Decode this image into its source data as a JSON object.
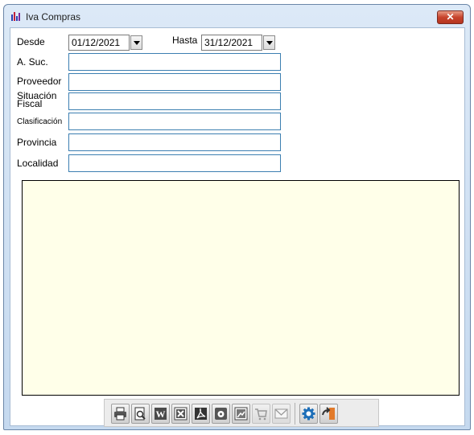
{
  "window": {
    "title": "Iva Compras",
    "close_symbol": "✕"
  },
  "form": {
    "desde_label": "Desde",
    "desde_value": "01/12/2021",
    "hasta_label": "Hasta",
    "hasta_value": "31/12/2021",
    "suc_label": "A. Suc.",
    "proveedor_label": "Proveedor",
    "situacion_label_1": "Situación",
    "situacion_label_2": "Fiscal",
    "clasificacion_label": "Clasificación",
    "provincia_label": "Provincia",
    "localidad_label": "Localidad",
    "suc_value": "",
    "proveedor_value": "",
    "situacion_value": "",
    "clasificacion_value": "",
    "provincia_value": "",
    "localidad_value": ""
  },
  "colors": {
    "grid_background": "#ffffe9",
    "field_border": "#3c7fb1",
    "close_button": "#c7432c"
  },
  "toolbar": {
    "buttons": [
      {
        "icon": "printer-icon",
        "enabled": true
      },
      {
        "icon": "print-preview-icon",
        "enabled": true
      },
      {
        "icon": "word-icon",
        "enabled": true
      },
      {
        "icon": "excel-icon",
        "enabled": true
      },
      {
        "icon": "pdf-icon",
        "enabled": true
      },
      {
        "icon": "disk-icon",
        "enabled": true
      },
      {
        "icon": "image-export-icon",
        "enabled": true
      },
      {
        "icon": "cart-icon",
        "enabled": false
      },
      {
        "icon": "mail-icon",
        "enabled": false
      },
      {
        "icon": "settings-gear-icon",
        "enabled": true
      },
      {
        "icon": "exit-door-icon",
        "enabled": true
      }
    ]
  }
}
